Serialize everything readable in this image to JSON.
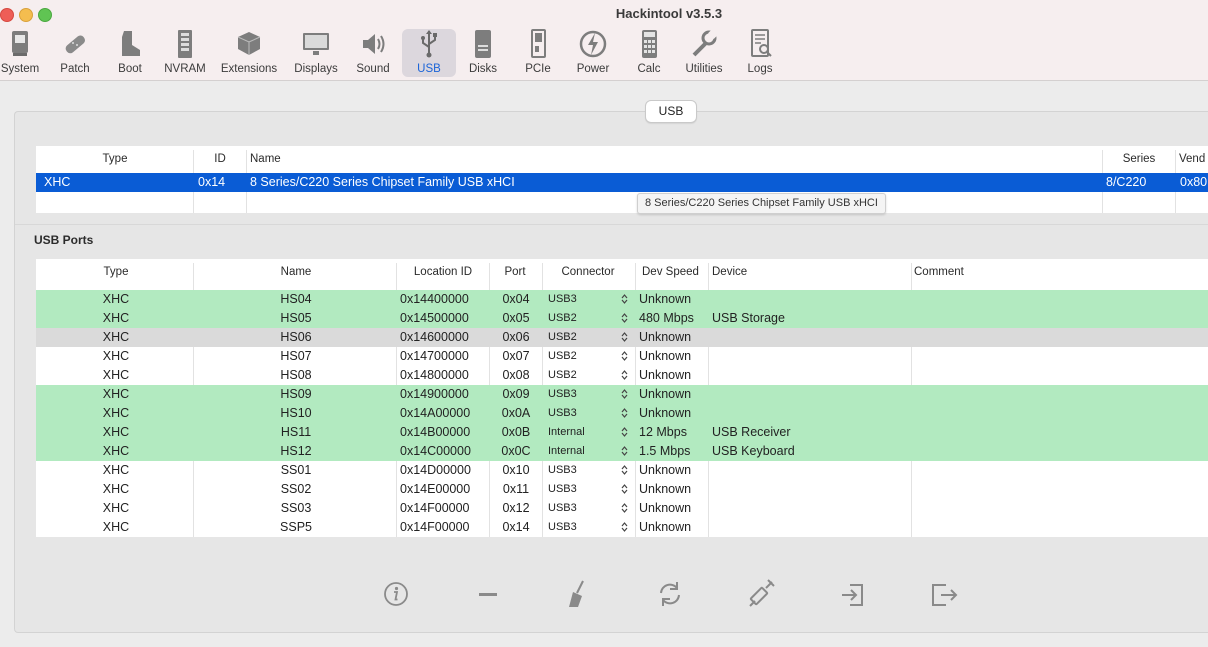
{
  "window": {
    "title": "Hackintool v3.5.3"
  },
  "toolbar": {
    "items": [
      {
        "label": "System",
        "icon": "system-icon"
      },
      {
        "label": "Patch",
        "icon": "patch-icon"
      },
      {
        "label": "Boot",
        "icon": "boot-icon"
      },
      {
        "label": "NVRAM",
        "icon": "nvram-icon"
      },
      {
        "label": "Extensions",
        "icon": "extensions-icon"
      },
      {
        "label": "Displays",
        "icon": "displays-icon"
      },
      {
        "label": "Sound",
        "icon": "sound-icon"
      },
      {
        "label": "USB",
        "icon": "usb-icon",
        "active": true
      },
      {
        "label": "Disks",
        "icon": "disks-icon"
      },
      {
        "label": "PCIe",
        "icon": "pcie-icon"
      },
      {
        "label": "Power",
        "icon": "power-icon"
      },
      {
        "label": "Calc",
        "icon": "calc-icon"
      },
      {
        "label": "Utilities",
        "icon": "utilities-icon"
      },
      {
        "label": "Logs",
        "icon": "logs-icon"
      }
    ]
  },
  "usb_tab": {
    "label": "USB"
  },
  "controllers": {
    "headers": {
      "type": "Type",
      "id": "ID",
      "name": "Name",
      "series": "Series",
      "vendor": "Vend"
    },
    "rows": [
      {
        "type": "XHC",
        "id": "0x14",
        "name": "8 Series/C220 Series Chipset Family USB xHCI",
        "series": "8/C220",
        "vendor": "0x80"
      }
    ],
    "tooltip": "8 Series/C220 Series Chipset Family USB xHCI"
  },
  "usb_ports": {
    "title": "USB Ports",
    "headers": {
      "type": "Type",
      "name": "Name",
      "location": "Location ID",
      "port": "Port",
      "connector": "Connector",
      "speed": "Dev Speed",
      "device": "Device",
      "comment": "Comment"
    },
    "rows": [
      {
        "type": "XHC",
        "name": "HS04",
        "location": "0x14400000",
        "port": "0x04",
        "connector": "USB3",
        "speed": "Unknown",
        "device": "",
        "status": "green"
      },
      {
        "type": "XHC",
        "name": "HS05",
        "location": "0x14500000",
        "port": "0x05",
        "connector": "USB2",
        "speed": "480 Mbps",
        "device": "USB Storage",
        "status": "green"
      },
      {
        "type": "XHC",
        "name": "HS06",
        "location": "0x14600000",
        "port": "0x06",
        "connector": "USB2",
        "speed": "Unknown",
        "device": "",
        "status": "grey"
      },
      {
        "type": "XHC",
        "name": "HS07",
        "location": "0x14700000",
        "port": "0x07",
        "connector": "USB2",
        "speed": "Unknown",
        "device": "",
        "status": "none"
      },
      {
        "type": "XHC",
        "name": "HS08",
        "location": "0x14800000",
        "port": "0x08",
        "connector": "USB2",
        "speed": "Unknown",
        "device": "",
        "status": "none"
      },
      {
        "type": "XHC",
        "name": "HS09",
        "location": "0x14900000",
        "port": "0x09",
        "connector": "USB3",
        "speed": "Unknown",
        "device": "",
        "status": "green"
      },
      {
        "type": "XHC",
        "name": "HS10",
        "location": "0x14A00000",
        "port": "0x0A",
        "connector": "USB3",
        "speed": "Unknown",
        "device": "",
        "status": "green"
      },
      {
        "type": "XHC",
        "name": "HS11",
        "location": "0x14B00000",
        "port": "0x0B",
        "connector": "Internal",
        "speed": "12 Mbps",
        "device": "USB Receiver",
        "status": "green"
      },
      {
        "type": "XHC",
        "name": "HS12",
        "location": "0x14C00000",
        "port": "0x0C",
        "connector": "Internal",
        "speed": "1.5 Mbps",
        "device": "USB Keyboard",
        "status": "green"
      },
      {
        "type": "XHC",
        "name": "SS01",
        "location": "0x14D00000",
        "port": "0x10",
        "connector": "USB3",
        "speed": "Unknown",
        "device": "",
        "status": "none"
      },
      {
        "type": "XHC",
        "name": "SS02",
        "location": "0x14E00000",
        "port": "0x11",
        "connector": "USB3",
        "speed": "Unknown",
        "device": "",
        "status": "none"
      },
      {
        "type": "XHC",
        "name": "SS03",
        "location": "0x14F00000",
        "port": "0x12",
        "connector": "USB3",
        "speed": "Unknown",
        "device": "",
        "status": "none"
      },
      {
        "type": "XHC",
        "name": "SSP5",
        "location": "0x14F00000",
        "port": "0x14",
        "connector": "USB3",
        "speed": "Unknown",
        "device": "",
        "status": "none"
      }
    ]
  },
  "bottom_toolbar": {
    "icons": [
      "info-icon",
      "remove-icon",
      "clear-icon",
      "refresh-icon",
      "inject-icon",
      "import-icon",
      "export-icon"
    ]
  },
  "colors": {
    "selection": "#0a5cd5",
    "active_port": "#b2eac0",
    "inactive_port": "#dadada",
    "accent": "#1c64d8"
  }
}
